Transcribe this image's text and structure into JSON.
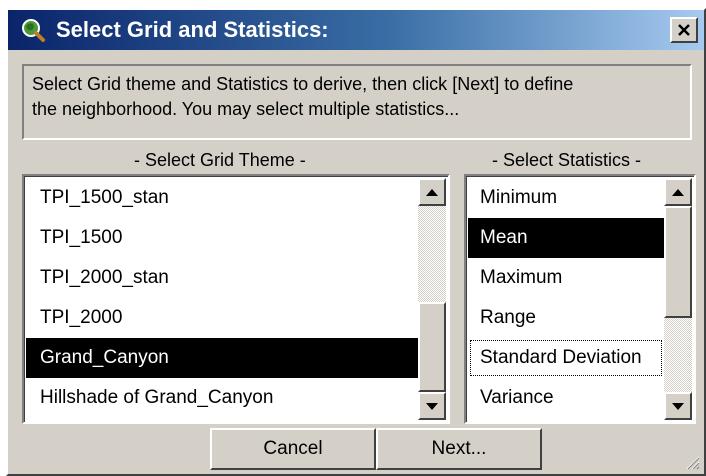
{
  "window": {
    "title": "Select Grid and Statistics:",
    "close_glyph": "✕",
    "app_icon": "globe-magnifier-icon"
  },
  "instructions": {
    "line1": "Select Grid theme and Statistics to derive, then click [Next] to define",
    "line2": "the neighborhood.  You may select multiple statistics..."
  },
  "grid_theme": {
    "label": "- Select Grid Theme -",
    "items": [
      {
        "label": "TPI_1500_stan",
        "selected": false
      },
      {
        "label": "TPI_1500",
        "selected": false
      },
      {
        "label": "TPI_2000_stan",
        "selected": false
      },
      {
        "label": "TPI_2000",
        "selected": false
      },
      {
        "label": "Grand_Canyon",
        "selected": true
      },
      {
        "label": "Hillshade of Grand_Canyon",
        "selected": false
      }
    ]
  },
  "statistics": {
    "label": "- Select Statistics -",
    "items": [
      {
        "label": "Minimum",
        "selected": false
      },
      {
        "label": "Mean",
        "selected": true
      },
      {
        "label": "Maximum",
        "selected": false
      },
      {
        "label": "Range",
        "selected": false
      },
      {
        "label": "Standard Deviation",
        "selected": false,
        "focused": true
      },
      {
        "label": "Variance",
        "selected": false
      }
    ]
  },
  "buttons": {
    "cancel_label": "Cancel",
    "next_label": "Next..."
  },
  "colors": {
    "title_gradient_start": "#0a246a",
    "face": "#d4d0c8",
    "selection": "#000000"
  }
}
